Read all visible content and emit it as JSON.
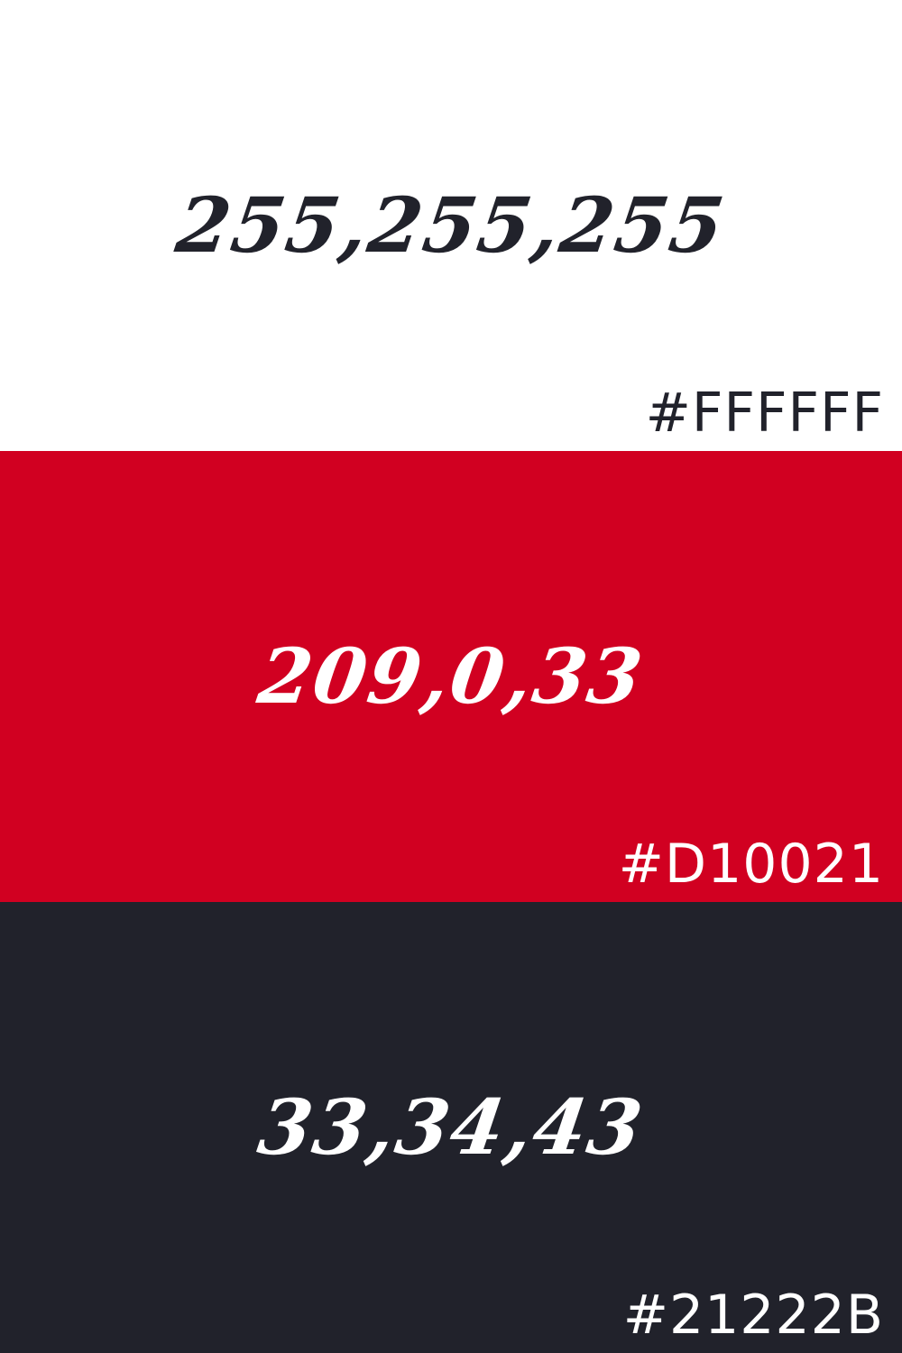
{
  "swatches": [
    {
      "rgb": "255,255,255",
      "hex": "#FFFFFF",
      "background": "#FFFFFF",
      "text_color": "#21222B"
    },
    {
      "rgb": "209,0,33",
      "hex": "#D10021",
      "background": "#D10021",
      "text_color": "#FFFFFF"
    },
    {
      "rgb": "33,34,43",
      "hex": "#21222B",
      "background": "#21222B",
      "text_color": "#FFFFFF"
    }
  ]
}
